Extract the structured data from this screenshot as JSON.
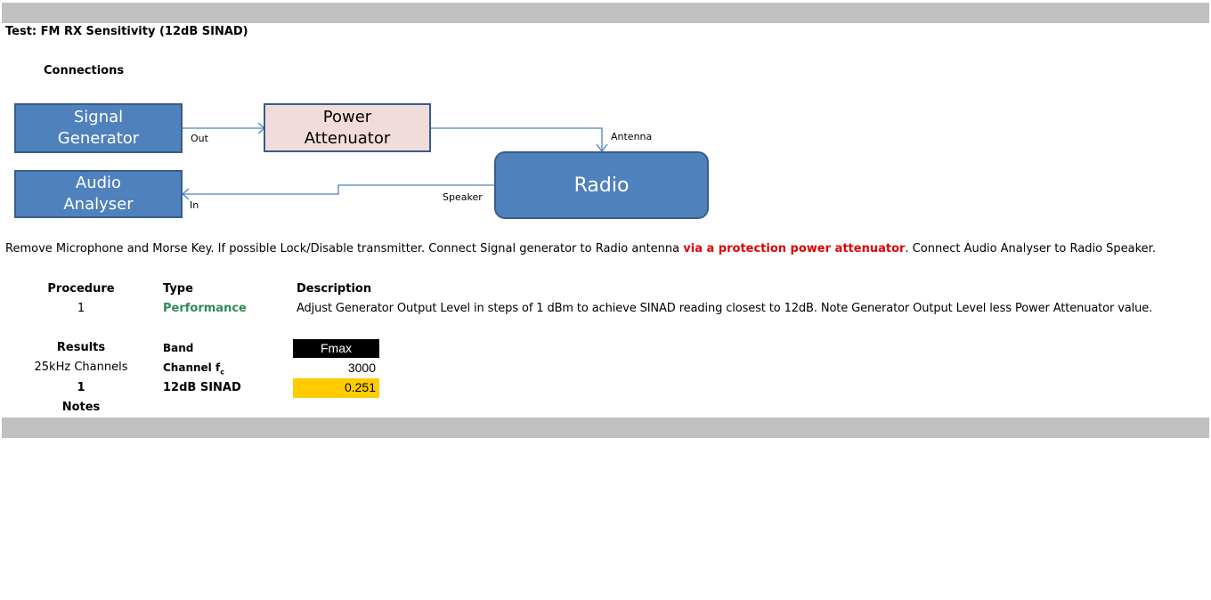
{
  "header": {
    "test_title": "Test: FM RX Sensitivity (12dB SINAD)",
    "connections_label": "Connections"
  },
  "diagram": {
    "signal_generator": [
      "Signal",
      "Generator"
    ],
    "power_attenuator": [
      "Power",
      "Attenuator"
    ],
    "radio": "Radio",
    "audio_analyser": [
      "Audio",
      "Analyser"
    ],
    "label_out": "Out",
    "label_antenna": "Antenna",
    "label_speaker": "Speaker",
    "label_in": "In",
    "colors": {
      "box_fill": "#4f81bd",
      "box_border": "#385d8a",
      "attenuator_fill": "#f2dcdb",
      "connector": "#4f81bd"
    }
  },
  "instructions": {
    "part1": "Remove Microphone and Morse Key. If possible Lock/Disable transmitter. Connect Signal generator to Radio antenna ",
    "highlight": "via a protection power attenuator",
    "part2": ". Connect Audio Analyser to Radio Speaker."
  },
  "procedure": {
    "headers": {
      "procedure": "Procedure",
      "type": "Type",
      "description": "Description"
    },
    "row": {
      "number": "1",
      "type": "Performance",
      "description": "Adjust Generator Output Level in steps of 1 dBm to achieve SINAD reading closest to 12dB. Note Generator Output Level less Power Attenuator value."
    }
  },
  "results": {
    "label": "Results",
    "channels": "25kHz Channels",
    "number": "1",
    "notes": "Notes",
    "band_label": "Band",
    "channel_label": "Channel f",
    "channel_subscript": "c",
    "sinad_label": "12dB SINAD",
    "fmax_header": "Fmax",
    "channel_value": "3000",
    "sinad_value": "0.251",
    "colors": {
      "highlight": "#ffcc00",
      "header_bg": "#000000"
    }
  }
}
